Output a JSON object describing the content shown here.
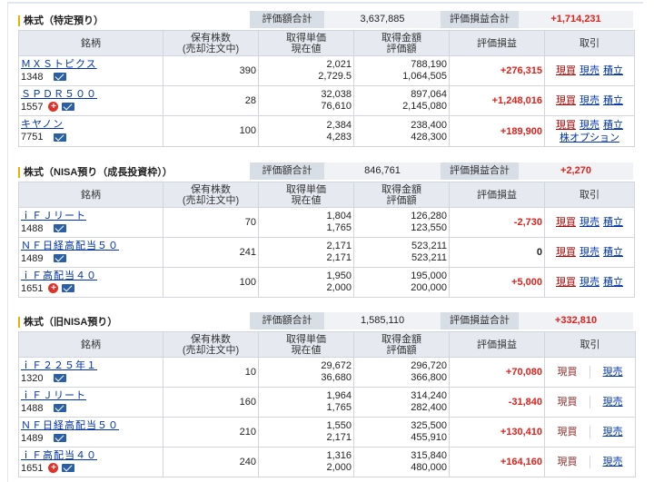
{
  "headers": {
    "col1": "銘柄",
    "col2a": "保有株数",
    "col2b": "(売却注文中)",
    "col3a": "取得単価",
    "col3b": "現在値",
    "col4a": "取得金額",
    "col4b": "評価額",
    "col5": "評価損益",
    "col6": "取引"
  },
  "summary_labels": {
    "value": "評価額合計",
    "pl": "評価損益合計"
  },
  "actions": {
    "buy": "現買",
    "sell": "現売",
    "accum": "積立",
    "option": "株オプション"
  },
  "sections": [
    {
      "title": "株式（特定預り）",
      "total_value": "3,637,885",
      "total_pl": "+1,714,231",
      "rows": [
        {
          "name": "ＭＸＳトピクス",
          "code": "1348",
          "plus": false,
          "qty": "390",
          "cost": "2,021",
          "price": "2,729.5",
          "cost_amt": "788,190",
          "value": "1,064,505",
          "pl": "+276,315",
          "pl_color": "red"
        },
        {
          "name": "ＳＰＤＲ５００",
          "code": "1557",
          "plus": true,
          "qty": "28",
          "cost": "32,038",
          "price": "76,610",
          "cost_amt": "897,064",
          "value": "2,145,080",
          "pl": "+1,248,016",
          "pl_color": "red"
        },
        {
          "name": "キヤノン",
          "code": "7751",
          "plus": false,
          "qty": "100",
          "cost": "2,384",
          "price": "4,283",
          "cost_amt": "238,400",
          "value": "428,300",
          "pl": "+189,900",
          "pl_color": "red"
        }
      ]
    },
    {
      "title": "株式（NISA預り（成長投資枠））",
      "total_value": "846,761",
      "total_pl": "+2,270",
      "rows": [
        {
          "name": "ｉＦＪリート",
          "code": "1488",
          "plus": false,
          "qty": "70",
          "cost": "1,804",
          "price": "1,765",
          "cost_amt": "126,280",
          "value": "123,550",
          "pl": "-2,730",
          "pl_color": "red"
        },
        {
          "name": "ＮＦ日経高配当５０",
          "code": "1489",
          "plus": false,
          "qty": "241",
          "cost": "2,171",
          "price": "2,171",
          "cost_amt": "523,211",
          "value": "523,211",
          "pl": "0",
          "pl_color": "blk"
        },
        {
          "name": "ｉＦ高配当４０",
          "code": "1651",
          "plus": true,
          "qty": "100",
          "cost": "1,950",
          "price": "2,000",
          "cost_amt": "195,000",
          "value": "200,000",
          "pl": "+5,000",
          "pl_color": "red"
        }
      ]
    },
    {
      "title": "株式（旧NISA預り）",
      "total_value": "1,585,110",
      "total_pl": "+332,810",
      "rows": [
        {
          "name": "ｉＦ２２５年１",
          "code": "1320",
          "plus": false,
          "qty": "10",
          "cost": "29,672",
          "price": "36,680",
          "cost_amt": "296,720",
          "value": "366,800",
          "pl": "+70,080",
          "pl_color": "red"
        },
        {
          "name": "ｉＦＪリート",
          "code": "1488",
          "plus": false,
          "qty": "160",
          "cost": "1,964",
          "price": "1,765",
          "cost_amt": "314,240",
          "value": "282,400",
          "pl": "-31,840",
          "pl_color": "red"
        },
        {
          "name": "ＮＦ日経高配当５０",
          "code": "1489",
          "plus": false,
          "qty": "210",
          "cost": "1,550",
          "price": "2,171",
          "cost_amt": "325,500",
          "value": "455,910",
          "pl": "+130,410",
          "pl_color": "red"
        },
        {
          "name": "ｉＦ高配当４０",
          "code": "1651",
          "plus": true,
          "qty": "240",
          "cost": "1,316",
          "price": "2,000",
          "cost_amt": "315,840",
          "value": "480,000",
          "pl": "+164,160",
          "pl_color": "red"
        }
      ]
    }
  ]
}
